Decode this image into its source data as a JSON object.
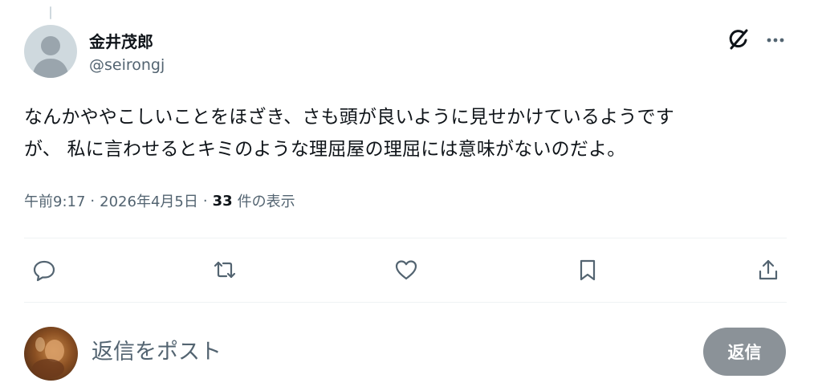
{
  "author": {
    "display_name": "金井茂郎",
    "handle": "@seirongj",
    "avatar_icon": "default-avatar-icon"
  },
  "header_actions": {
    "grok_icon": "grok-icon",
    "more_icon": "more-horizontal-icon"
  },
  "tweet": {
    "text": "なんかややこしいことをほざき、さも頭が良いように見せかけているようです\nが、 私に言わせるとキミのような理屈屋の理屈には意味がないのだよ。"
  },
  "meta": {
    "time": "午前9:17",
    "separator": "·",
    "date": "2026年4月5日",
    "views_count": "33",
    "views_label": "件の表示"
  },
  "actions": [
    {
      "name": "reply",
      "icon": "reply-icon"
    },
    {
      "name": "repost",
      "icon": "repost-icon"
    },
    {
      "name": "like",
      "icon": "heart-icon"
    },
    {
      "name": "bookmark",
      "icon": "bookmark-icon"
    },
    {
      "name": "share",
      "icon": "share-icon"
    }
  ],
  "composer": {
    "placeholder": "返信をポスト",
    "value": "",
    "reply_button_label": "返信"
  },
  "colors": {
    "text_primary": "#0f1419",
    "text_secondary": "#536471",
    "divider": "#eff3f4",
    "button_disabled": "#8b9298"
  }
}
